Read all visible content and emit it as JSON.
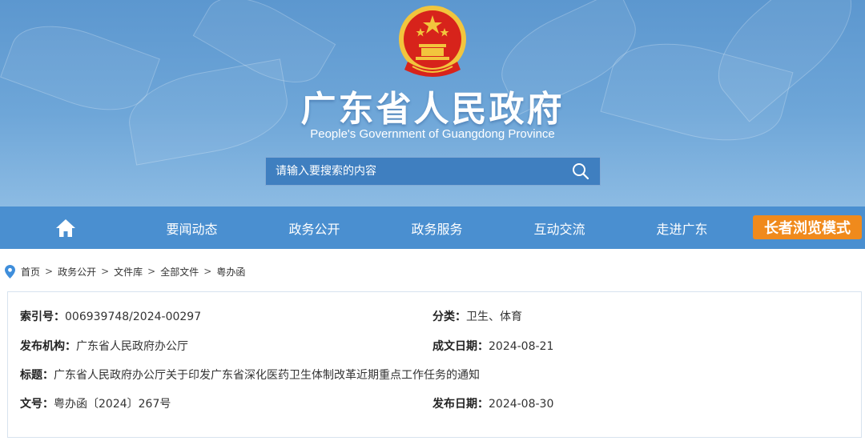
{
  "header": {
    "title": "广东省人民政府",
    "subtitle": "People's Government of Guangdong Province",
    "search": {
      "placeholder": "请输入要搜索的内容",
      "icon": "search-icon"
    }
  },
  "nav": {
    "home_icon": "home-icon",
    "items": [
      {
        "label": "要闻动态"
      },
      {
        "label": "政务公开"
      },
      {
        "label": "政务服务"
      },
      {
        "label": "互动交流"
      },
      {
        "label": "走进广东"
      }
    ],
    "elder_mode": "长者浏览模式"
  },
  "breadcrumb": {
    "icon": "location-pin-icon",
    "separator": ">",
    "items": [
      "首页",
      "政务公开",
      "文件库",
      "全部文件",
      "粤办函"
    ]
  },
  "document_info": {
    "index_no": {
      "label": "索引号：",
      "value": "006939748/2024-00297"
    },
    "category": {
      "label": "分类：",
      "value": "卫生、体育"
    },
    "issuer": {
      "label": "发布机构：",
      "value": "广东省人民政府办公厅"
    },
    "created_date": {
      "label": "成文日期：",
      "value": "2024-08-21"
    },
    "title": {
      "label": "标题：",
      "value": "广东省人民政府办公厅关于印发广东省深化医药卫生体制改革近期重点工作任务的通知"
    },
    "doc_no": {
      "label": "文号：",
      "value": "粤办函〔2024〕267号"
    },
    "publish_date": {
      "label": "发布日期：",
      "value": "2024-08-30"
    }
  },
  "colors": {
    "banner": "#6ea6d8",
    "nav": "#4a8fd0",
    "elder_button": "#f08a1c",
    "emblem_red": "#d7231b",
    "emblem_gold": "#f2c53d"
  }
}
